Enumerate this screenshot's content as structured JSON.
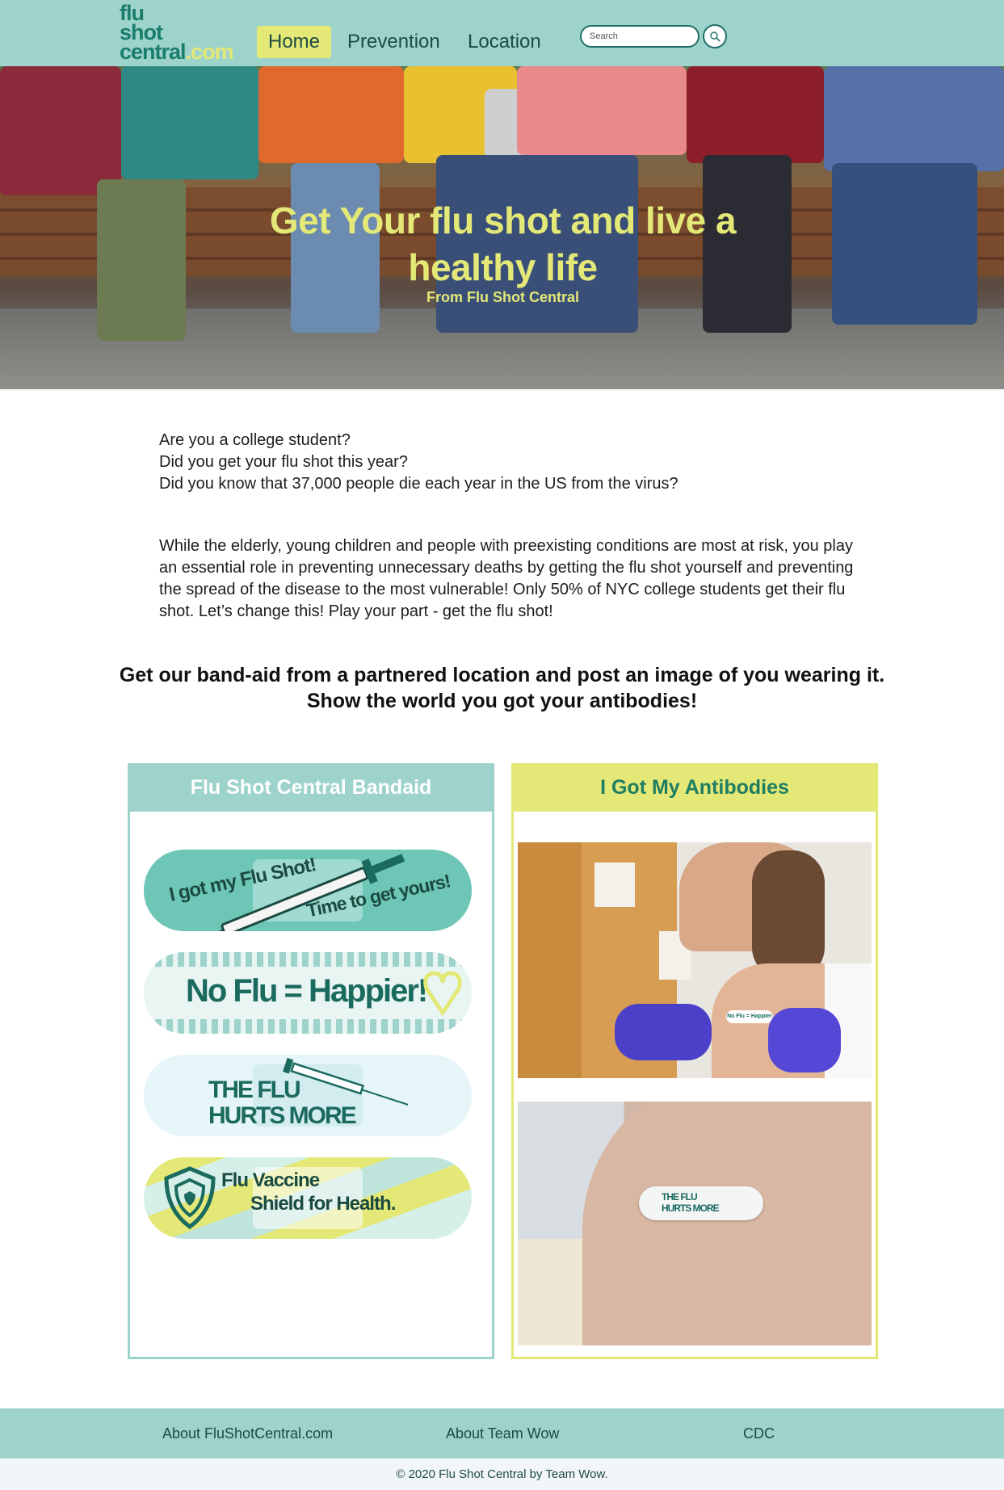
{
  "logo": {
    "line1": "flu",
    "line2": "shot",
    "line3a": "central",
    "line3b": ".com"
  },
  "nav": {
    "items": [
      {
        "label": "Home"
      },
      {
        "label": "Prevention"
      },
      {
        "label": "Location"
      }
    ],
    "search_placeholder": "Search",
    "search_icon": "search-icon"
  },
  "hero": {
    "title": "Get Your flu shot and live a healthy life",
    "subtitle": "From Flu Shot Central"
  },
  "intro": {
    "lines": [
      "Are you a college student?",
      "Did you get your flu shot this year?",
      "Did you know that 37,000 people die each year in the US from the virus?"
    ],
    "paragraph": "While the elderly, young children and people with preexisting conditions are most at risk, you play an essential role in preventing unnecessary deaths by getting the flu shot yourself and preventing the spread of the disease to the most vulnerable! Only 50% of NYC college students get their flu shot. Let’s change this! Play your part - get the flu shot!"
  },
  "cta": {
    "line1": "Get our band-aid from a partnered location and post an image of you wearing it.",
    "line2": "Show the world you got your antibodies!"
  },
  "cards": {
    "left": {
      "title": "Flu Shot Central Bandaid",
      "bandaids": {
        "b1_line1": "I got my Flu Shot!",
        "b1_line2": "Time to get yours!",
        "b2": "No Flu = Happier!",
        "b3_line1": "THE FLU",
        "b3_line2": "HURTS MORE",
        "b4_line1": "Flu Vaccine",
        "b4_line2": "Shield for Health."
      }
    },
    "right": {
      "title": "I Got My Antibodies",
      "photo1_bandaid": "No Flu = Happier",
      "photo2_line1": "THE FLU",
      "photo2_line2": "HURTS MORE"
    }
  },
  "footer": {
    "links": [
      {
        "label": "About FluShotCentral.com"
      },
      {
        "label": "About Team Wow"
      },
      {
        "label": "CDC"
      }
    ],
    "copyright": "© 2020 Flu Shot Central by Team Wow."
  },
  "colors": {
    "teal": "#9dd3cb",
    "yellow": "#e3e877",
    "dark_teal": "#1a7d6c"
  }
}
